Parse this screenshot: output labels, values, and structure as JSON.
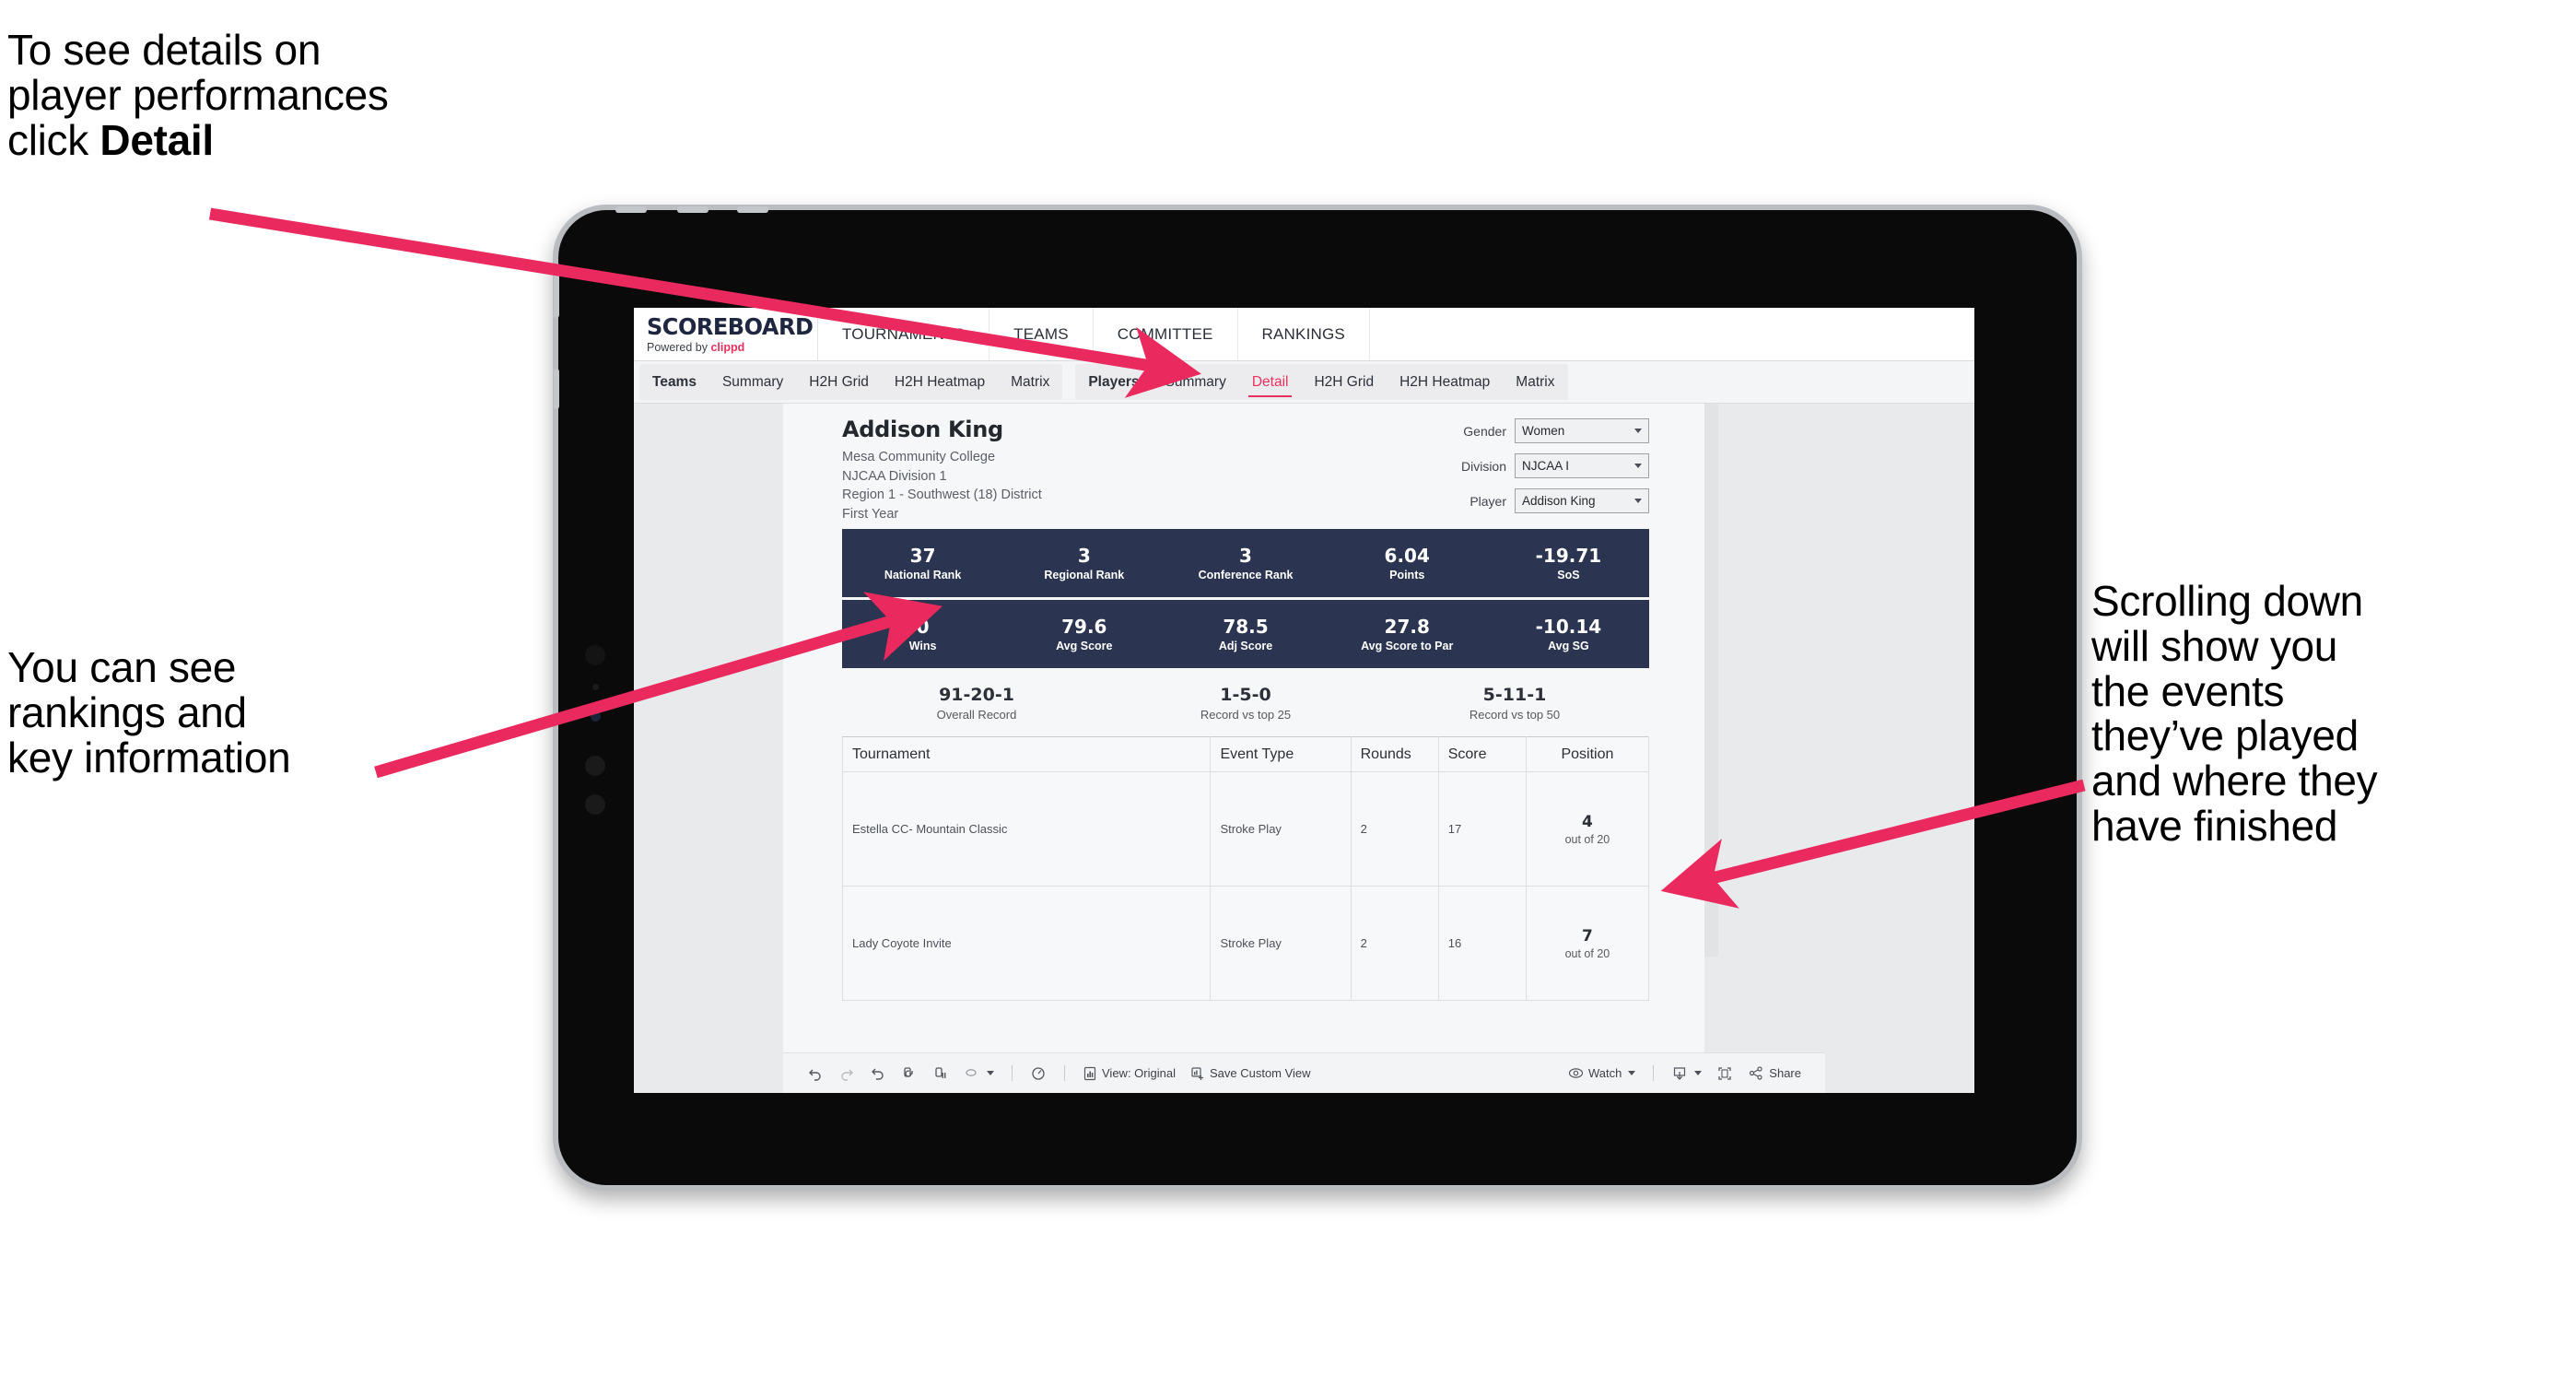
{
  "annotations": {
    "top_left": {
      "line1": "To see details on",
      "line2": "player performances",
      "line3_prefix": "click ",
      "line3_bold": "Detail"
    },
    "left": {
      "line1": "You can see",
      "line2": "rankings and",
      "line3": "key information"
    },
    "right": {
      "line1": "Scrolling down",
      "line2": "will show you",
      "line3": "the events",
      "line4": "they’ve played",
      "line5": "and where they",
      "line6": "have finished"
    },
    "arrow_color": "#ea2a5f"
  },
  "app": {
    "brand": {
      "title": "SCOREBOARD",
      "powered_prefix": "Powered by ",
      "powered_name": "clippd"
    },
    "nav": [
      "TOURNAMENTS",
      "TEAMS",
      "COMMITTEE",
      "RANKINGS"
    ],
    "tabs_teams": [
      {
        "label": "Teams",
        "active": false,
        "head": true
      },
      {
        "label": "Summary",
        "active": false
      },
      {
        "label": "H2H Grid",
        "active": false
      },
      {
        "label": "H2H Heatmap",
        "active": false
      },
      {
        "label": "Matrix",
        "active": false
      }
    ],
    "tabs_players": [
      {
        "label": "Players",
        "active": false,
        "head": true
      },
      {
        "label": "Summary",
        "active": false
      },
      {
        "label": "Detail",
        "active": true
      },
      {
        "label": "H2H Grid",
        "active": false
      },
      {
        "label": "H2H Heatmap",
        "active": false
      },
      {
        "label": "Matrix",
        "active": false
      }
    ],
    "accent": "#e8315f",
    "band_color": "#2b3450"
  },
  "player": {
    "name": "Addison King",
    "school": "Mesa Community College",
    "division": "NJCAA Division 1",
    "region": "Region 1 - Southwest (18) District",
    "year": "First Year"
  },
  "filters": [
    {
      "label": "Gender",
      "value": "Women"
    },
    {
      "label": "Division",
      "value": "NJCAA I"
    },
    {
      "label": "Player",
      "value": "Addison King"
    }
  ],
  "stats_band_1": [
    {
      "value": "37",
      "label": "National Rank"
    },
    {
      "value": "3",
      "label": "Regional Rank"
    },
    {
      "value": "3",
      "label": "Conference Rank"
    },
    {
      "value": "6.04",
      "label": "Points"
    },
    {
      "value": "-19.71",
      "label": "SoS"
    }
  ],
  "stats_band_2": [
    {
      "value": "0",
      "label": "Wins"
    },
    {
      "value": "79.6",
      "label": "Avg Score"
    },
    {
      "value": "78.5",
      "label": "Adj Score"
    },
    {
      "value": "27.8",
      "label": "Avg Score to Par"
    },
    {
      "value": "-10.14",
      "label": "Avg SG"
    }
  ],
  "records": [
    {
      "value": "91-20-1",
      "label": "Overall Record"
    },
    {
      "value": "1-5-0",
      "label": "Record vs top 25"
    },
    {
      "value": "5-11-1",
      "label": "Record vs top 50"
    }
  ],
  "events_table": {
    "headers": [
      "Tournament",
      "Event Type",
      "Rounds",
      "Score",
      "Position"
    ],
    "rows": [
      {
        "tournament": "Estella CC- Mountain Classic",
        "event_type": "Stroke Play",
        "rounds": "2",
        "score": "17",
        "position_num": "4",
        "position_of": "out of 20"
      },
      {
        "tournament": "Lady Coyote Invite",
        "event_type": "Stroke Play",
        "rounds": "2",
        "score": "16",
        "position_num": "7",
        "position_of": "out of 20"
      }
    ]
  },
  "toolbar": {
    "view_original": "View: Original",
    "save_custom_view": "Save Custom View",
    "watch": "Watch",
    "share": "Share"
  }
}
